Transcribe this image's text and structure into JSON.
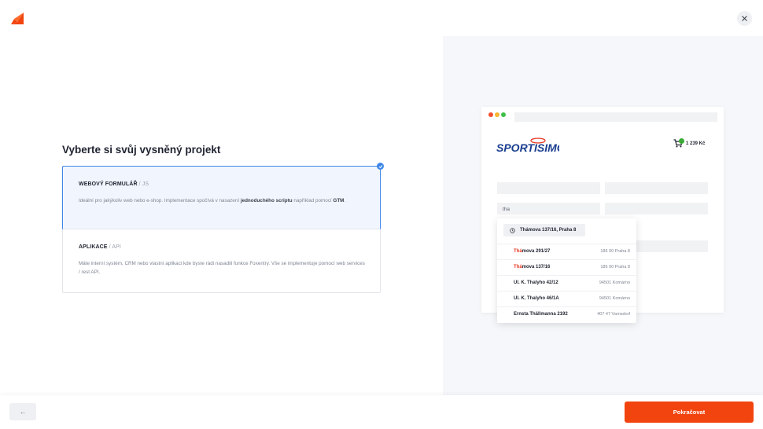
{
  "page": {
    "title": "Vyberte si svůj vysněný projekt"
  },
  "options": [
    {
      "title": "WEBOVÝ FORMULÁŘ",
      "subtitle": " / JS",
      "desc_before": "Ideální pro jakýkoliv web nebo e-shop. Implementace spočívá v nasazení ",
      "desc_bold1": "jednoduchého scriptu",
      "desc_middle": " například pomocí ",
      "desc_bold2": "GTM",
      "desc_after": ".",
      "selected": true
    },
    {
      "title": "APLIKACE",
      "subtitle": " / API",
      "desc": "Máte interní systém, CRM nebo vlastní aplikaci kde byste rádi nasadili funkce Foxentry. Vše se implementuje pomocí web services / rest API.",
      "selected": false
    }
  ],
  "preview": {
    "brand": "SPORTISIMO",
    "cart_amount": "1 239 Kč",
    "cart_count": "2",
    "input_value": "tha",
    "recent_label": "Thámova 137/16, Praha 8",
    "suggestions": [
      {
        "highlight": "Thá",
        "rest": "mova 291/27",
        "zip": "186 00 Praha 8",
        "flag": "cz"
      },
      {
        "highlight": "Thá",
        "rest": "mova 137/16",
        "zip": "186 00 Praha 8",
        "flag": "cz"
      },
      {
        "highlight": "",
        "rest": "Ul. K. Thalyho 42/12",
        "zip": "94501 Komárno",
        "flag": "sk"
      },
      {
        "highlight": "",
        "rest": "Ul. K. Thalyho 46/1A",
        "zip": "94501 Komárno",
        "flag": "sk"
      },
      {
        "highlight": "",
        "rest": "Ernsta Thällmanna 2192",
        "zip": "407 47 Varnsdorf",
        "flag": "cz"
      }
    ],
    "dot_colors": [
      "#f1502f",
      "#f5b52e",
      "#3fbf4a"
    ]
  },
  "footer": {
    "back_label": "←",
    "next_label": "Pokračovat"
  },
  "colors": {
    "accent": "#f2440f",
    "selected_border": "#3d86e8",
    "brand_blue": "#1a3e8f",
    "brand_red": "#e8321c"
  }
}
